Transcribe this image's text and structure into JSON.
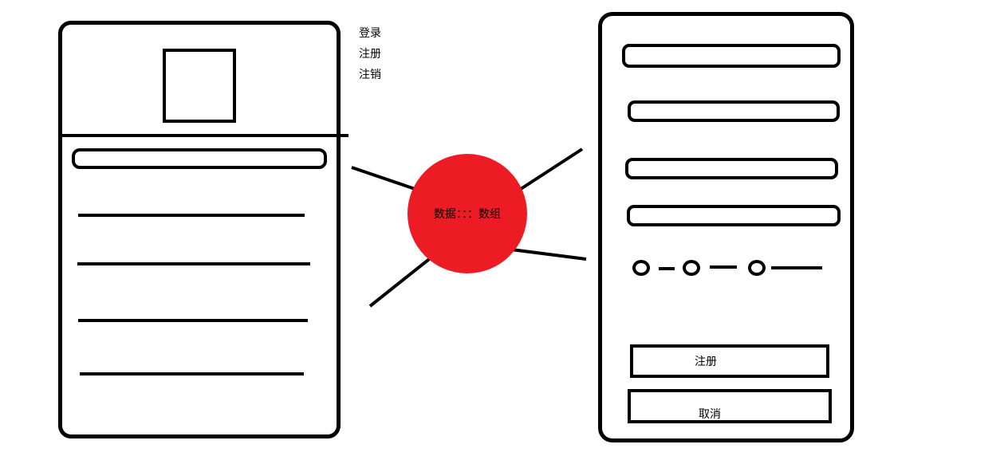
{
  "side_menu": {
    "items": [
      {
        "label": "登录"
      },
      {
        "label": "注册"
      },
      {
        "label": "注销"
      }
    ]
  },
  "data_hub": {
    "label": "数据：：：数组",
    "color": "#ed1c24"
  },
  "register_form": {
    "submit_label": "注册",
    "cancel_label": "取消"
  }
}
